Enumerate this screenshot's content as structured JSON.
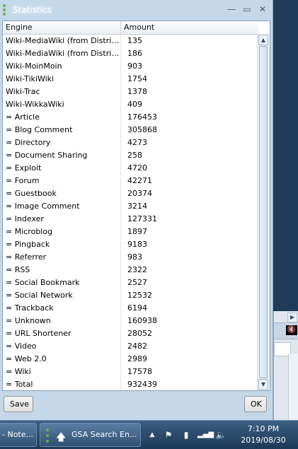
{
  "window": {
    "title": "Statistics",
    "minimize_glyph": "—",
    "maximize_glyph": "▭",
    "close_glyph": "✕"
  },
  "table": {
    "columns": [
      "Engine",
      "Amount"
    ],
    "rows": [
      [
        "Wiki-MediaWiki (from Distributi...",
        "135"
      ],
      [
        "Wiki-MediaWiki (from Distributi...",
        "186"
      ],
      [
        "Wiki-MoinMoin",
        "903"
      ],
      [
        "Wiki-TikiWiki",
        "1754"
      ],
      [
        "Wiki-Trac",
        "1378"
      ],
      [
        "Wiki-WikkaWiki",
        "409"
      ],
      [
        " = Article",
        "176453"
      ],
      [
        " = Blog Comment",
        "305868"
      ],
      [
        " = Directory",
        "4273"
      ],
      [
        " = Document Sharing",
        "258"
      ],
      [
        " = Exploit",
        "4720"
      ],
      [
        " = Forum",
        "42271"
      ],
      [
        " = Guestbook",
        "20374"
      ],
      [
        " = Image Comment",
        "3214"
      ],
      [
        " = Indexer",
        "127331"
      ],
      [
        " = Microblog",
        "1897"
      ],
      [
        " = Pingback",
        "9183"
      ],
      [
        " = Referrer",
        "983"
      ],
      [
        " = RSS",
        "2322"
      ],
      [
        " = Social Bookmark",
        "2527"
      ],
      [
        " = Social Network",
        "12532"
      ],
      [
        " = Trackback",
        "6194"
      ],
      [
        " = Unknown",
        "160938"
      ],
      [
        " = URL Shortener",
        "28052"
      ],
      [
        " = Video",
        "2482"
      ],
      [
        " = Web 2.0",
        "2989"
      ],
      [
        " = Wiki",
        "17578"
      ],
      [
        " = Total",
        "932439"
      ]
    ]
  },
  "buttons": {
    "save": "Save",
    "ok": "OK"
  },
  "taskbar": {
    "tasks": [
      "- Note...",
      "GSA Search En..."
    ],
    "clock_time": "7:10 PM",
    "clock_date": "2019/08/30"
  },
  "icons": {
    "scroll_up": "up-arrow",
    "scroll_down": "down-arrow",
    "tray": [
      "chevron-up",
      "flag",
      "power",
      "network",
      "volume"
    ],
    "mute": "mute"
  },
  "colors": {
    "window_frame": "#c5d8ea",
    "taskbar": "#2a4a6c"
  }
}
